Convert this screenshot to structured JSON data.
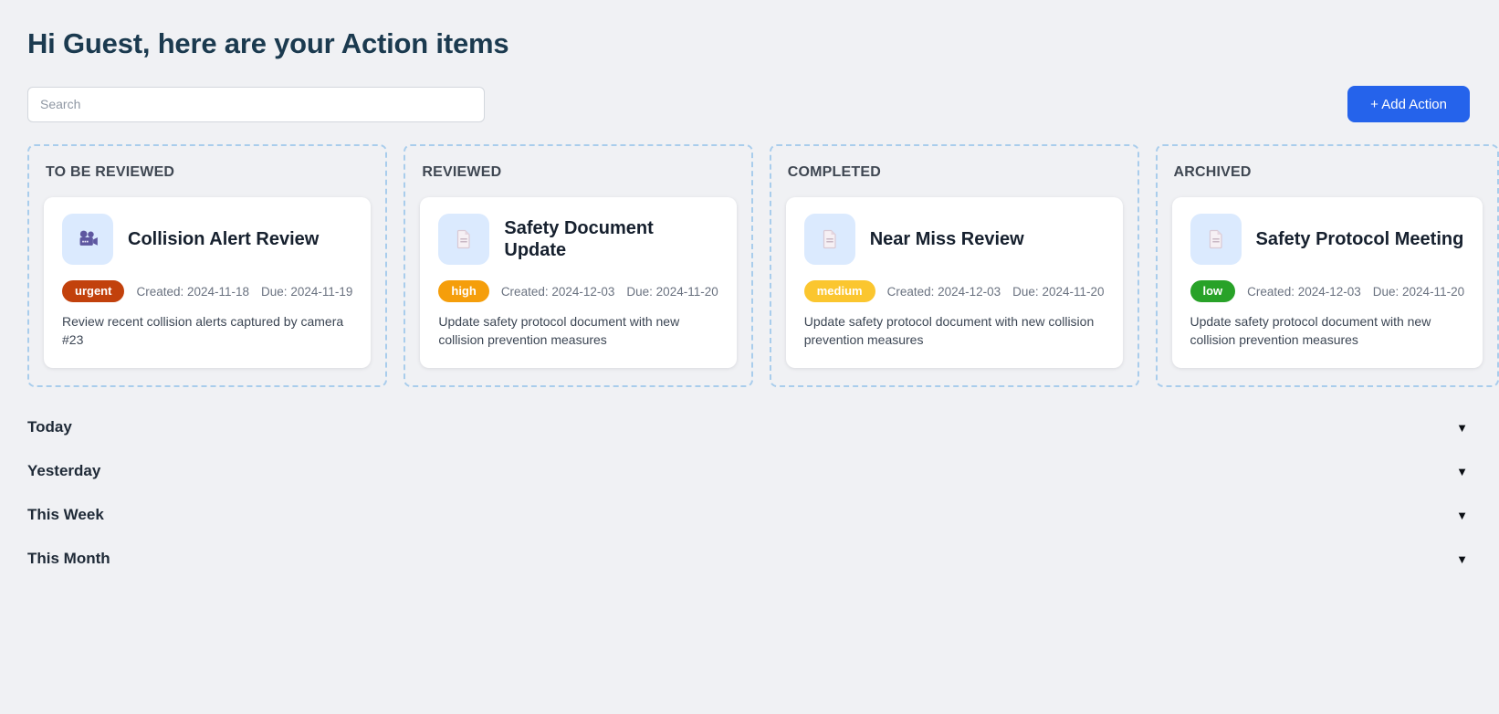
{
  "header": {
    "greeting": "Hi Guest, here are your Action items"
  },
  "toolbar": {
    "search": {
      "placeholder": "Search",
      "value": ""
    },
    "add_action": {
      "label": "+ Add Action",
      "color": "#2563eb"
    }
  },
  "colors": {
    "page_bg": "#f0f1f4",
    "board_border": "#a9cdec",
    "icon_box_bg": "#dbeafe",
    "accent": "#2563eb"
  },
  "board": {
    "columns": [
      {
        "label": "TO BE REVIEWED",
        "card": {
          "icon": "movie-camera-icon",
          "title": "Collision Alert Review",
          "priority": {
            "text": "urgent",
            "color": "#c2410c"
          },
          "created_label": "Created: 2024-11-18",
          "due_label": "Due: 2024-11-19",
          "description": "Review recent collision alerts captured by camera #23"
        }
      },
      {
        "label": "REVIEWED",
        "card": {
          "icon": "document-icon",
          "title": "Safety Document Update",
          "priority": {
            "text": "high",
            "color": "#f59e0b"
          },
          "created_label": "Created: 2024-12-03",
          "due_label": "Due: 2024-11-20",
          "description": "Update safety protocol document with new collision prevention measures"
        }
      },
      {
        "label": "COMPLETED",
        "card": {
          "icon": "document-icon",
          "title": "Near Miss Review",
          "priority": {
            "text": "medium",
            "color": "#fbc62f"
          },
          "created_label": "Created: 2024-12-03",
          "due_label": "Due: 2024-11-20",
          "description": "Update safety protocol document with new collision prevention measures"
        }
      },
      {
        "label": "ARCHIVED",
        "card": {
          "icon": "document-icon",
          "title": "Safety Protocol Meeting",
          "priority": {
            "text": "low",
            "color": "#28a228"
          },
          "created_label": "Created: 2024-12-03",
          "due_label": "Due: 2024-11-20",
          "description": "Update safety protocol document with new collision prevention measures"
        }
      }
    ]
  },
  "timeline": {
    "sections": [
      {
        "label": "Today",
        "collapse_icon": "▼"
      },
      {
        "label": "Yesterday",
        "collapse_icon": "▼"
      },
      {
        "label": "This Week",
        "collapse_icon": "▼"
      },
      {
        "label": "This Month",
        "collapse_icon": "▼"
      }
    ]
  }
}
